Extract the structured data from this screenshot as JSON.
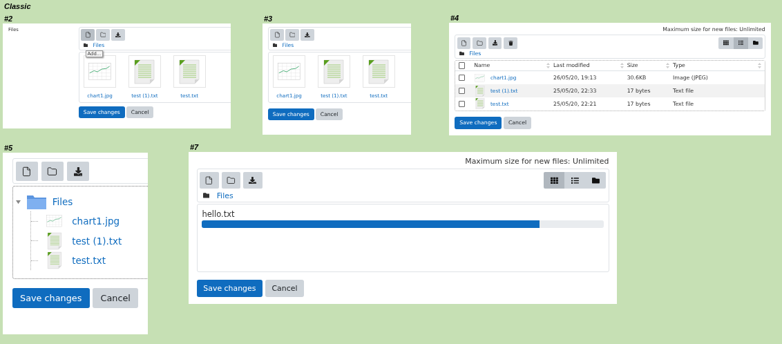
{
  "sheet_title": "Classic",
  "examples": [
    {
      "label": "#2",
      "kind": "icons",
      "field_label": "Files",
      "toolbar": [
        {
          "kind": "add",
          "hovered": true
        },
        {
          "kind": "folder",
          "hovered": false
        },
        {
          "kind": "download",
          "hovered": false
        }
      ],
      "tooltip": "Add...",
      "breadcrumb": "Files",
      "files": [
        {
          "name": "chart1.jpg",
          "kind": "image"
        },
        {
          "name": "test (1).txt",
          "kind": "text"
        },
        {
          "name": "test.txt",
          "kind": "text"
        }
      ],
      "buttons": [
        {
          "label": "Save changes",
          "kind": "primary"
        },
        {
          "label": "Cancel",
          "kind": "secondary"
        }
      ]
    },
    {
      "label": "#3",
      "kind": "icons",
      "toolbar": [
        {
          "kind": "add",
          "hovered": false
        },
        {
          "kind": "folder",
          "hovered": false
        },
        {
          "kind": "download",
          "hovered": false
        }
      ],
      "breadcrumb": "Files",
      "files": [
        {
          "name": "chart1.jpg",
          "kind": "image"
        },
        {
          "name": "test (1).txt",
          "kind": "text"
        },
        {
          "name": "test.txt",
          "kind": "text"
        }
      ],
      "buttons": [
        {
          "label": "Save changes",
          "kind": "primary"
        },
        {
          "label": "Cancel",
          "kind": "secondary"
        }
      ]
    },
    {
      "label": "#4",
      "kind": "table",
      "max_size": "Maximum size for new files: Unlimited",
      "toolbar": [
        {
          "kind": "add",
          "hovered": false
        },
        {
          "kind": "folder",
          "hovered": false
        },
        {
          "kind": "download",
          "hovered": false
        },
        {
          "kind": "delete",
          "hovered": false
        }
      ],
      "view_toggles": [
        {
          "kind": "icons",
          "selected": false
        },
        {
          "kind": "list",
          "selected": true
        },
        {
          "kind": "tree",
          "selected": false
        }
      ],
      "breadcrumb": "Files",
      "select_all_checked": false,
      "columns": [
        "Name",
        "Last modified",
        "Size",
        "Type"
      ],
      "files": [
        {
          "name": "chart1.jpg",
          "kind": "image",
          "modified": "26/05/20, 19:13",
          "size": "30.6KB",
          "type": "Image (JPEG)",
          "checked": false
        },
        {
          "name": "test (1).txt",
          "kind": "text",
          "modified": "25/05/20, 22:33",
          "size": "17 bytes",
          "type": "Text file",
          "checked": false
        },
        {
          "name": "test.txt",
          "kind": "text",
          "modified": "25/05/20, 22:21",
          "size": "17 bytes",
          "type": "Text file",
          "checked": false
        }
      ],
      "buttons": [
        {
          "label": "Save changes",
          "kind": "primary"
        },
        {
          "label": "Cancel",
          "kind": "secondary"
        }
      ]
    },
    {
      "label": "#5",
      "kind": "tree",
      "toolbar": [
        {
          "kind": "add",
          "hovered": false
        },
        {
          "kind": "folder",
          "hovered": false
        },
        {
          "kind": "download",
          "hovered": false
        }
      ],
      "tree": {
        "name": "Files",
        "expanded": true,
        "children": [
          {
            "name": "chart1.jpg",
            "kind": "image"
          },
          {
            "name": "test (1).txt",
            "kind": "text"
          },
          {
            "name": "test.txt",
            "kind": "text"
          }
        ]
      },
      "buttons": [
        {
          "label": "Save changes",
          "kind": "primary"
        },
        {
          "label": "Cancel",
          "kind": "secondary"
        }
      ]
    },
    {
      "label": "#7",
      "kind": "upload",
      "max_size": "Maximum size for new files: Unlimited",
      "toolbar": [
        {
          "kind": "add",
          "hovered": false
        },
        {
          "kind": "folder",
          "hovered": false
        },
        {
          "kind": "download",
          "hovered": false
        }
      ],
      "view_toggles": [
        {
          "kind": "icons",
          "selected": true
        },
        {
          "kind": "list",
          "selected": false
        },
        {
          "kind": "tree",
          "selected": false
        }
      ],
      "breadcrumb": "Files",
      "uploads": [
        {
          "name": "hello.txt",
          "level": 0.84
        }
      ],
      "buttons": [
        {
          "label": "Save changes",
          "kind": "primary"
        },
        {
          "label": "Cancel",
          "kind": "secondary"
        }
      ]
    }
  ]
}
